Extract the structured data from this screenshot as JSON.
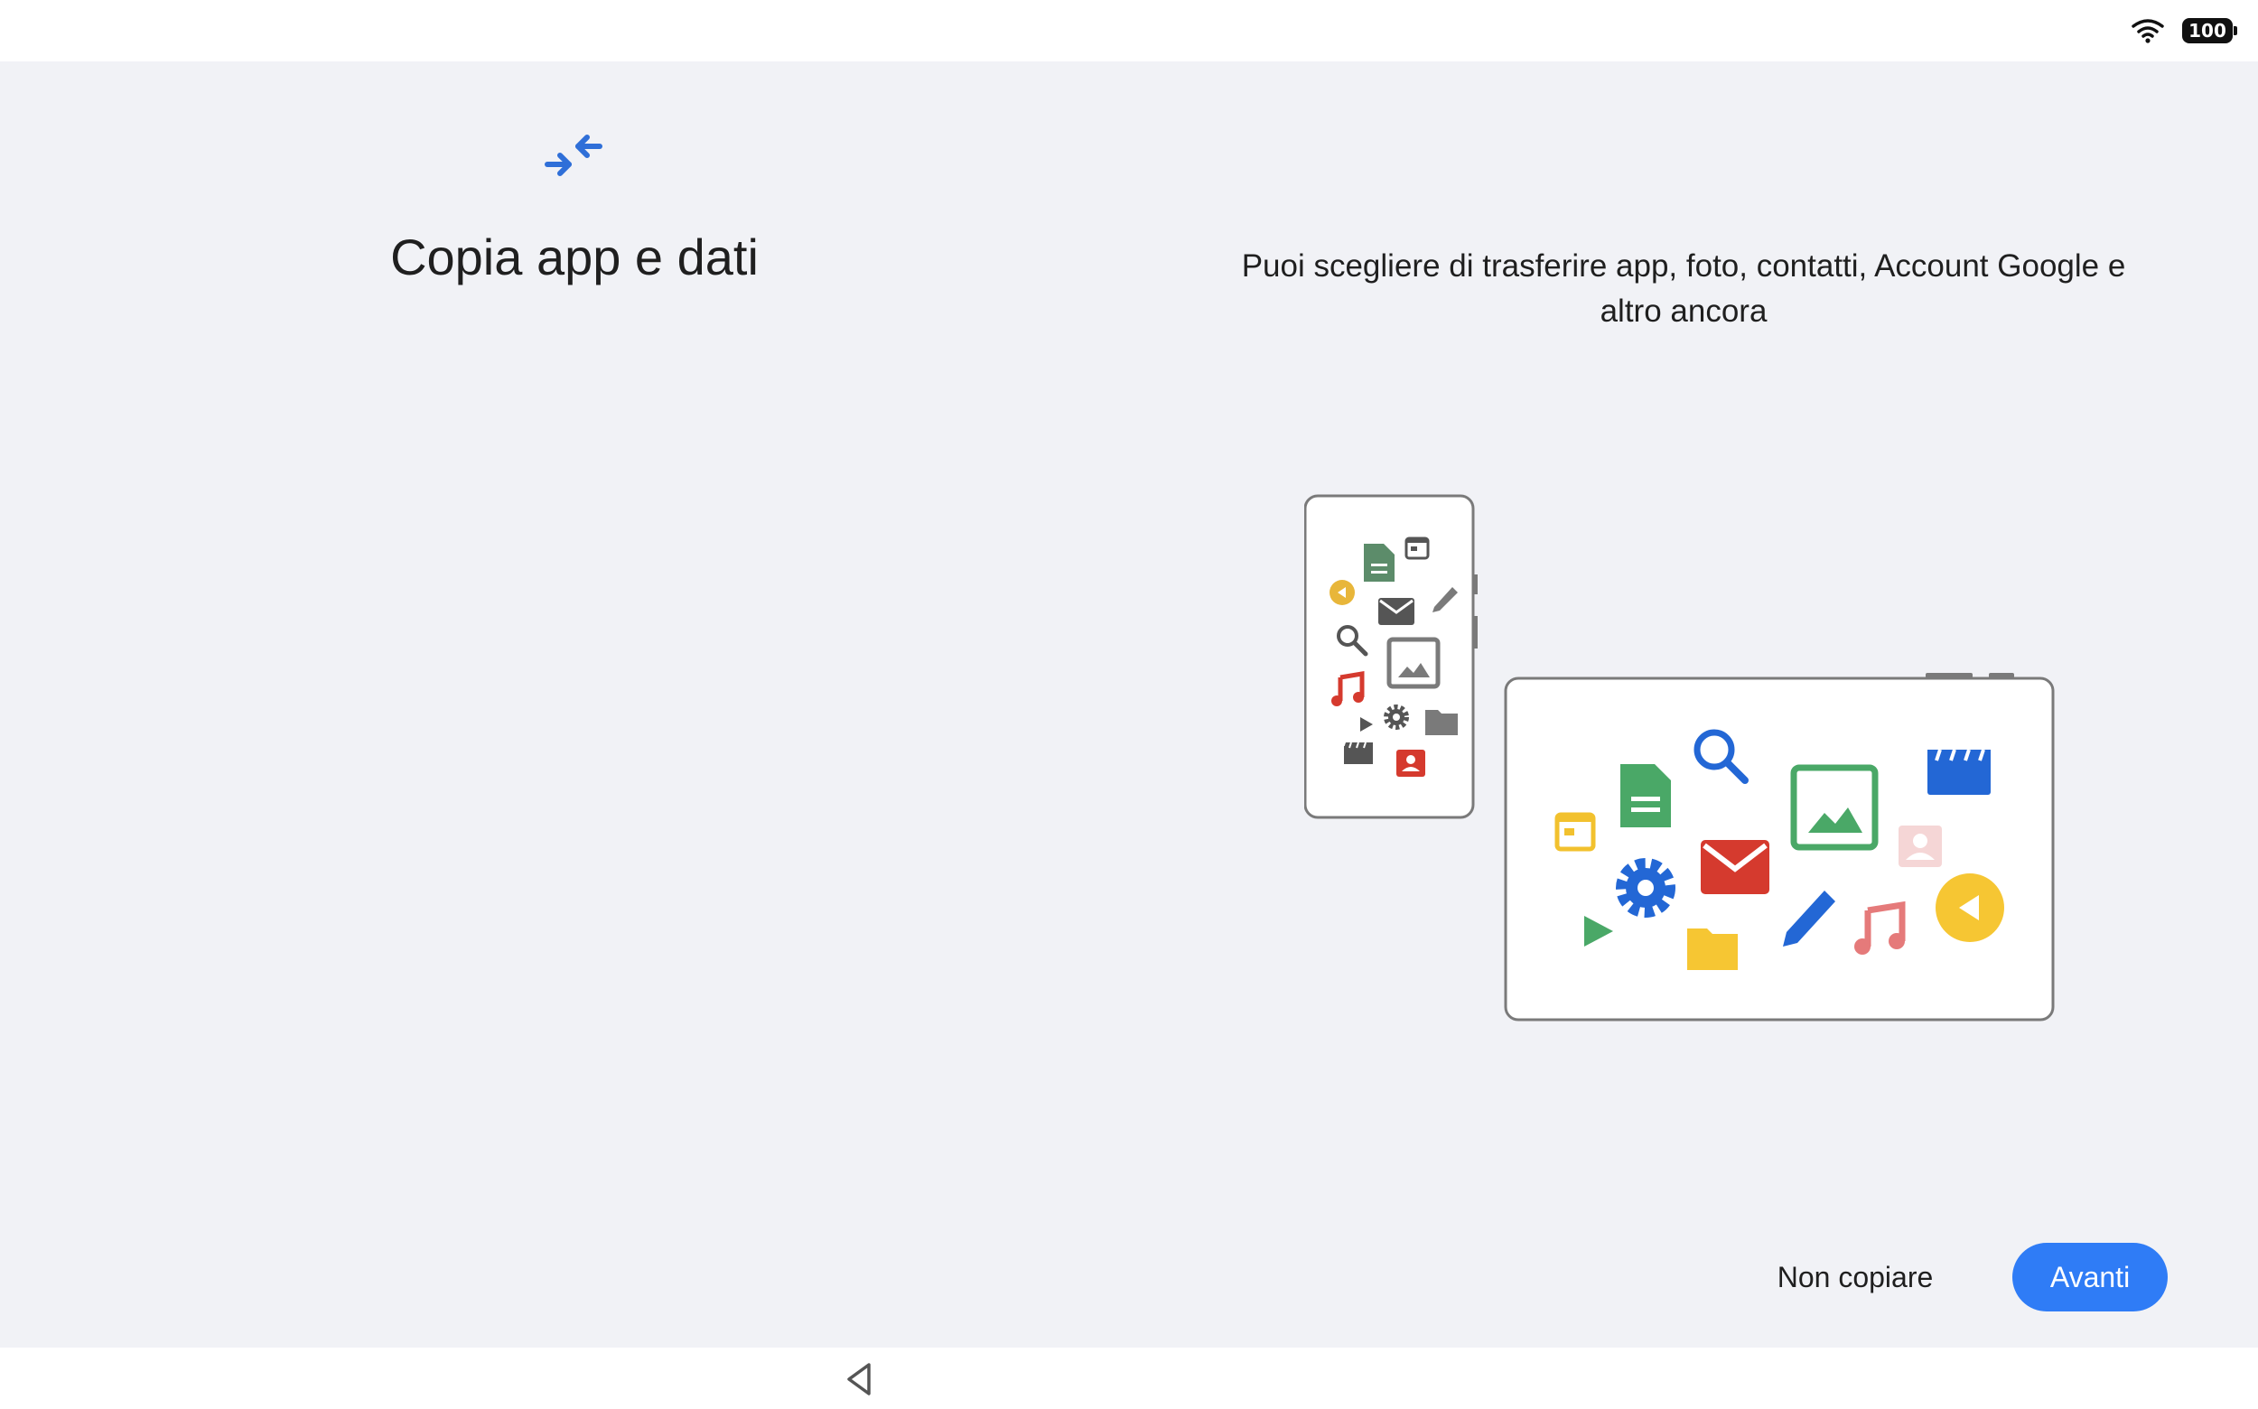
{
  "status_bar": {
    "battery_level": "100",
    "icons": [
      "wifi-icon",
      "battery-icon"
    ]
  },
  "header": {
    "icon": "transfer-arrows-icon",
    "title": "Copia app e dati"
  },
  "main": {
    "description": "Puoi scegliere di trasferire app, foto, contatti, Account Google e altro ancora"
  },
  "illustration": {
    "icons": [
      "document-icon",
      "calendar-icon",
      "mail-icon",
      "pencil-icon",
      "search-icon",
      "image-icon",
      "music-icon",
      "settings-icon",
      "folder-icon",
      "play-icon",
      "clapperboard-icon",
      "contact-icon",
      "audio-icon"
    ]
  },
  "actions": {
    "skip_label": "Non copiare",
    "next_label": "Avanti"
  },
  "colors": {
    "accent": "#2f7cf6",
    "background": "#f1f2f6"
  },
  "nav_bar": {
    "icons": [
      "back-icon"
    ]
  }
}
